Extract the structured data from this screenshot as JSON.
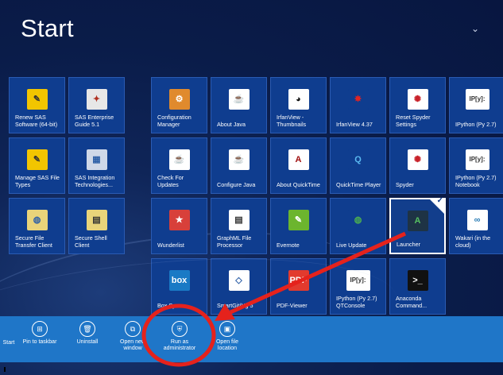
{
  "screen": {
    "title": "Start",
    "scroll_glyph": "⌄"
  },
  "tiles": [
    {
      "name": "tile-renew-sas",
      "label": "Renew SAS Software (64-bit)",
      "icon": "sas-icon",
      "glyph": "✎",
      "bg": "#f2c500",
      "fg": "#333333"
    },
    {
      "name": "tile-sas-guide",
      "label": "SAS Enterprise Guide 5.1",
      "icon": "compass-icon",
      "glyph": "✦",
      "bg": "#e7e7e7",
      "fg": "#b03020"
    },
    {
      "name": "tile-manage-sas",
      "label": "Manage SAS File Types",
      "icon": "sas-icon",
      "glyph": "✎",
      "bg": "#f2c500",
      "fg": "#333333"
    },
    {
      "name": "tile-sas-integration",
      "label": "SAS Integration Technologies...",
      "icon": "window-icon",
      "glyph": "▦",
      "bg": "#cfd8e8",
      "fg": "#2d5fa7"
    },
    {
      "name": "tile-secure-transfer",
      "label": "Secure File Transfer Client",
      "icon": "transfer-icon",
      "glyph": "◍",
      "bg": "#e9d47a",
      "fg": "#2d5fa7"
    },
    {
      "name": "tile-secure-shell",
      "label": "Secure Shell Client",
      "icon": "terminal-icon",
      "glyph": "▤",
      "bg": "#e9d47a",
      "fg": "#333333"
    },
    {
      "name": "tile-config-manager",
      "label": "Configuration Manager",
      "icon": "config-icon",
      "glyph": "⚙",
      "bg": "#e08a2d",
      "fg": "#ffffff"
    },
    {
      "name": "tile-about-java",
      "label": "About Java",
      "icon": "java-icon",
      "glyph": "☕",
      "bg": "#ffffff",
      "fg": "#c8422b"
    },
    {
      "name": "tile-irfanview-thumbs",
      "label": "IrfanView - Thumbnails",
      "icon": "panda-icon",
      "glyph": "◕",
      "bg": "#ffffff",
      "fg": "#111111"
    },
    {
      "name": "tile-irfanview",
      "label": "IrfanView 4.37",
      "icon": "irfanview-icon",
      "glyph": "✸",
      "bg": "#0f3d8f",
      "fg": "#e02424"
    },
    {
      "name": "tile-reset-spyder",
      "label": "Reset Spyder Settings",
      "icon": "spyder-icon",
      "glyph": "✺",
      "bg": "#ffffff",
      "fg": "#c8222a"
    },
    {
      "name": "tile-ipython",
      "label": "IPython (Py 2.7)",
      "icon": "ipython-icon",
      "glyph": "IP[y]:",
      "bg": "#ffffff",
      "fg": "#333333"
    },
    {
      "name": "tile-check-updates",
      "label": "Check For Updates",
      "icon": "java-icon",
      "glyph": "☕",
      "bg": "#ffffff",
      "fg": "#c8422b"
    },
    {
      "name": "tile-configure-java",
      "label": "Configure Java",
      "icon": "java-icon",
      "glyph": "☕",
      "bg": "#ffffff",
      "fg": "#c8422b"
    },
    {
      "name": "tile-about-quicktime",
      "label": "About QuickTime",
      "icon": "document-icon",
      "glyph": "A",
      "bg": "#ffffff",
      "fg": "#a01010"
    },
    {
      "name": "tile-quicktime",
      "label": "QuickTime Player",
      "icon": "quicktime-icon",
      "glyph": "Q",
      "bg": "#0f3d8f",
      "fg": "#5ab8f0"
    },
    {
      "name": "tile-spyder",
      "label": "Spyder",
      "icon": "spyder-icon",
      "glyph": "✺",
      "bg": "#ffffff",
      "fg": "#c8222a"
    },
    {
      "name": "tile-ipython-notebook",
      "label": "IPython (Py 2.7) Notebook",
      "icon": "ipython-icon",
      "glyph": "IP[y]:",
      "bg": "#ffffff",
      "fg": "#333333"
    },
    {
      "name": "tile-wunderlist",
      "label": "Wunderlist",
      "icon": "wunderlist-icon",
      "glyph": "★",
      "bg": "#d8403a",
      "fg": "#ffffff"
    },
    {
      "name": "tile-graphml",
      "label": "GraphML File Processor",
      "icon": "document-icon",
      "glyph": "▤",
      "bg": "#ffffff",
      "fg": "#333333"
    },
    {
      "name": "tile-evernote",
      "label": "Evernote",
      "icon": "evernote-icon",
      "glyph": "✎",
      "bg": "#6cb52e",
      "fg": "#ffffff"
    },
    {
      "name": "tile-live-update",
      "label": "Live Update",
      "icon": "globe-icon",
      "glyph": "◍",
      "bg": "#0f3d8f",
      "fg": "#4caf50"
    },
    {
      "name": "tile-launcher",
      "label": "Launcher",
      "icon": "anaconda-icon",
      "glyph": "A",
      "bg": "#1e3345",
      "fg": "#55c060"
    },
    {
      "name": "tile-wakari",
      "label": "Wakari (in the cloud)",
      "icon": "wakari-icon",
      "glyph": "∞",
      "bg": "#ffffff",
      "fg": "#2b7db5"
    },
    {
      "name": "tile-box",
      "label": "Box Sync",
      "icon": "box-icon",
      "glyph": "box",
      "bg": "#1a7ac5",
      "fg": "#ffffff"
    },
    {
      "name": "tile-smartgit",
      "label": "SmartGit/Hg 5",
      "icon": "smartgit-icon",
      "glyph": "◇",
      "bg": "#ffffff",
      "fg": "#2d5fa7"
    },
    {
      "name": "tile-pdf-viewer",
      "label": "PDF-Viewer",
      "icon": "pdf-icon",
      "glyph": "PDF",
      "bg": "#e23a2e",
      "fg": "#ffffff"
    },
    {
      "name": "tile-ipython-qt",
      "label": "IPython (Py 2.7) QTConsole",
      "icon": "ipython-icon",
      "glyph": "IP[y]:",
      "bg": "#ffffff",
      "fg": "#333333"
    },
    {
      "name": "tile-anaconda-cmd",
      "label": "Anaconda Command...",
      "icon": "terminal-icon",
      "glyph": ">_",
      "bg": "#111111",
      "fg": "#ffffff"
    }
  ],
  "appbar": {
    "commands": [
      {
        "name": "start-button",
        "label": "Start",
        "icon": "start-icon",
        "glyph": ""
      },
      {
        "name": "pin-to-taskbar-button",
        "label": "Pin to taskbar",
        "icon": "pin-icon",
        "glyph": "⊞"
      },
      {
        "name": "uninstall-button",
        "label": "Uninstall",
        "icon": "trash-icon",
        "glyph": "🗑"
      },
      {
        "name": "open-new-window-button",
        "label": "Open new window",
        "icon": "new-window-icon",
        "glyph": "⧉"
      },
      {
        "name": "run-as-administrator-button",
        "label": "Run as administrator",
        "icon": "shield-icon",
        "glyph": "⛨"
      },
      {
        "name": "open-file-location-button",
        "label": "Open file location",
        "icon": "folder-icon",
        "glyph": "▣"
      }
    ],
    "bg": "#1f76c8"
  },
  "annotation": {
    "color": "#e5221c"
  }
}
